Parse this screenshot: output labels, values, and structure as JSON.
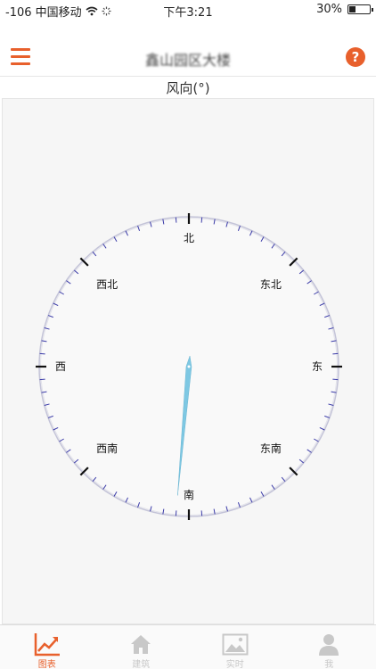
{
  "status_bar": {
    "carrier": "-106 中国移动",
    "time": "下午3:21",
    "battery": "30%",
    "battery_level": 0.3
  },
  "nav": {
    "title": "鑫山园区大楼",
    "menu_icon": "hamburger-icon",
    "help_icon": "question-circle-icon",
    "help_glyph": "?"
  },
  "chart_title": "风向(°)",
  "chart_data": {
    "type": "gauge",
    "title": "风向(°)",
    "min": 0,
    "max": 360,
    "value": 185,
    "direction_labels": [
      "北",
      "东北",
      "东",
      "东南",
      "南",
      "西南",
      "西",
      "西北"
    ],
    "needle_color": "#7ec8e3",
    "tick_color": "#3a3aa8"
  },
  "tabs": [
    {
      "label": "图表",
      "icon": "line-chart-icon",
      "active": true
    },
    {
      "label": "建筑",
      "icon": "home-icon",
      "active": false
    },
    {
      "label": "实时",
      "icon": "image-icon",
      "active": false
    },
    {
      "label": "我",
      "icon": "user-icon",
      "active": false
    }
  ],
  "colors": {
    "accent": "#e8602c",
    "inactive": "#c8c8c8"
  }
}
